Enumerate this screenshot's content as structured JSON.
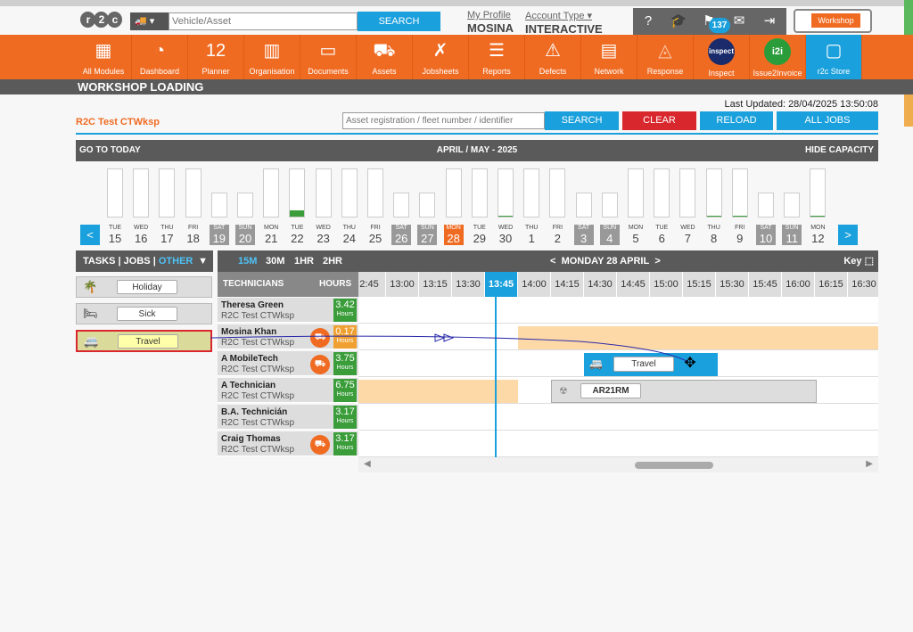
{
  "header": {
    "logo": "r2c",
    "vehicle_placeholder": "Vehicle/Asset",
    "search_label": "SEARCH",
    "profile_link": "My Profile",
    "profile_name": "MOSINA",
    "account_link": "Account Type",
    "account_type": "INTERACTIVE",
    "badge_count": "137",
    "workshop_label": "Workshop"
  },
  "modules": [
    {
      "label": "All Modules",
      "icon": "grid-icon"
    },
    {
      "label": "Dashboard",
      "icon": "gauge-icon"
    },
    {
      "label": "Planner",
      "icon": "calendar-icon",
      "glyph": "12"
    },
    {
      "label": "Organisation",
      "icon": "building-icon"
    },
    {
      "label": "Documents",
      "icon": "folder-icon"
    },
    {
      "label": "Assets",
      "icon": "truck-icon"
    },
    {
      "label": "Jobsheets",
      "icon": "tools-icon"
    },
    {
      "label": "Reports",
      "icon": "report-icon"
    },
    {
      "label": "Defects",
      "icon": "warning-icon"
    },
    {
      "label": "Network",
      "icon": "contacts-icon"
    },
    {
      "label": "Response",
      "icon": "response-icon"
    },
    {
      "label": "Inspect",
      "icon": "inspect-icon",
      "glyph": "inspect"
    },
    {
      "label": "Issue2Invoice",
      "icon": "i2i-icon",
      "glyph": "i2i"
    },
    {
      "label": "r2c Store",
      "icon": "store-icon"
    }
  ],
  "page": {
    "title": "WORKSHOP LOADING",
    "last_updated": "Last Updated: 28/04/2025 13:50:08",
    "workshop_name": "R2C Test CTWksp",
    "asset_placeholder": "Asset registration / fleet number / identifier",
    "search_label": "SEARCH",
    "clear_label": "CLEAR",
    "reload_label": "RELOAD",
    "all_jobs_label": "ALL JOBS"
  },
  "calendar": {
    "go_today": "GO TO TODAY",
    "month_label": "APRIL / MAY - 2025",
    "hide_capacity": "HIDE CAPACITY",
    "prev": "<",
    "next": ">",
    "days": [
      {
        "dow": "TUE",
        "num": "15",
        "type": "wd",
        "cap": 0
      },
      {
        "dow": "WED",
        "num": "16",
        "type": "wd",
        "cap": 0
      },
      {
        "dow": "THU",
        "num": "17",
        "type": "wd",
        "cap": 0
      },
      {
        "dow": "FRI",
        "num": "18",
        "type": "wd",
        "cap": 0
      },
      {
        "dow": "SAT",
        "num": "19",
        "type": "we",
        "cap": 0
      },
      {
        "dow": "SUN",
        "num": "20",
        "type": "we",
        "cap": 0
      },
      {
        "dow": "MON",
        "num": "21",
        "type": "wd",
        "cap": 0
      },
      {
        "dow": "TUE",
        "num": "22",
        "type": "wd",
        "cap": 0.14
      },
      {
        "dow": "WED",
        "num": "23",
        "type": "wd",
        "cap": 0
      },
      {
        "dow": "THU",
        "num": "24",
        "type": "wd",
        "cap": 0
      },
      {
        "dow": "FRI",
        "num": "25",
        "type": "wd",
        "cap": 0
      },
      {
        "dow": "SAT",
        "num": "26",
        "type": "we",
        "cap": 0
      },
      {
        "dow": "SUN",
        "num": "27",
        "type": "we",
        "cap": 0
      },
      {
        "dow": "MON",
        "num": "28",
        "type": "today",
        "cap": 0
      },
      {
        "dow": "TUE",
        "num": "29",
        "type": "wd",
        "cap": 0
      },
      {
        "dow": "WED",
        "num": "30",
        "type": "wd",
        "cap": 0.02
      },
      {
        "dow": "THU",
        "num": "1",
        "type": "wd",
        "cap": 0
      },
      {
        "dow": "FRI",
        "num": "2",
        "type": "wd",
        "cap": 0
      },
      {
        "dow": "SAT",
        "num": "3",
        "type": "we",
        "cap": 0
      },
      {
        "dow": "SUN",
        "num": "4",
        "type": "we",
        "cap": 0
      },
      {
        "dow": "MON",
        "num": "5",
        "type": "wd",
        "cap": 0
      },
      {
        "dow": "TUE",
        "num": "6",
        "type": "wd",
        "cap": 0
      },
      {
        "dow": "WED",
        "num": "7",
        "type": "wd",
        "cap": 0
      },
      {
        "dow": "THU",
        "num": "8",
        "type": "wd",
        "cap": 0.02
      },
      {
        "dow": "FRI",
        "num": "9",
        "type": "wd",
        "cap": 0.02
      },
      {
        "dow": "SAT",
        "num": "10",
        "type": "we",
        "cap": 0
      },
      {
        "dow": "SUN",
        "num": "11",
        "type": "we",
        "cap": 0
      },
      {
        "dow": "MON",
        "num": "12",
        "type": "wd",
        "cap": 0.02
      }
    ]
  },
  "tasks_panel": {
    "tab_tasks": "TASKS",
    "tab_jobs": "JOBS",
    "tab_other": "OTHER",
    "items": [
      {
        "label": "Holiday",
        "icon": "palm-tree-icon",
        "glyph": "🌴"
      },
      {
        "label": "Sick",
        "icon": "bed-icon",
        "glyph": "🛏"
      },
      {
        "label": "Travel",
        "icon": "travel-van-icon",
        "glyph": "🚐",
        "selected": true
      }
    ]
  },
  "scheduler": {
    "zoom_options": [
      "15M",
      "30M",
      "1HR",
      "2HR"
    ],
    "date_title": "MONDAY 28 APRIL",
    "prev": "<",
    "next": ">",
    "key_label": "Key",
    "tech_header": "TECHNICIANS",
    "hours_header": "HOURS",
    "time_slots": [
      "2:45",
      "13:00",
      "13:15",
      "13:30",
      "13:45",
      "14:00",
      "14:15",
      "14:30",
      "14:45",
      "15:00",
      "15:15",
      "15:30",
      "15:45",
      "16:00",
      "16:15",
      "16:30"
    ],
    "current_slot": "13:45",
    "technicians": [
      {
        "name": "Theresa Green",
        "site": "R2C Test CTWksp",
        "hours": "3.42",
        "unit": "Hours",
        "van": false,
        "status": "green"
      },
      {
        "name": "Mosina Khan",
        "site": "R2C Test CTWksp",
        "hours": "0.17",
        "unit": "Hours",
        "van": true,
        "status": "orange"
      },
      {
        "name": "A MobileTech",
        "site": "R2C Test CTWksp",
        "hours": "3.75",
        "unit": "Hours",
        "van": true,
        "status": "green"
      },
      {
        "name": "A Technician",
        "site": "R2C Test CTWksp",
        "hours": "6.75",
        "unit": "Hours",
        "van": false,
        "status": "green"
      },
      {
        "name": "B.A. Technicián",
        "site": "R2C Test CTWksp",
        "hours": "3.17",
        "unit": "Hours",
        "van": false,
        "status": "green"
      },
      {
        "name": "Craig Thomas",
        "site": "R2C Test CTWksp",
        "hours": "3.17",
        "unit": "Hours",
        "van": true,
        "status": "green"
      }
    ],
    "travel_block_label": "Travel",
    "job_block_label": "AR21RM"
  },
  "colors": {
    "brand_orange": "#f06b22",
    "accent_blue": "#1aa0dc",
    "clear_red": "#d9272e",
    "ok_green": "#3a9d3a"
  }
}
